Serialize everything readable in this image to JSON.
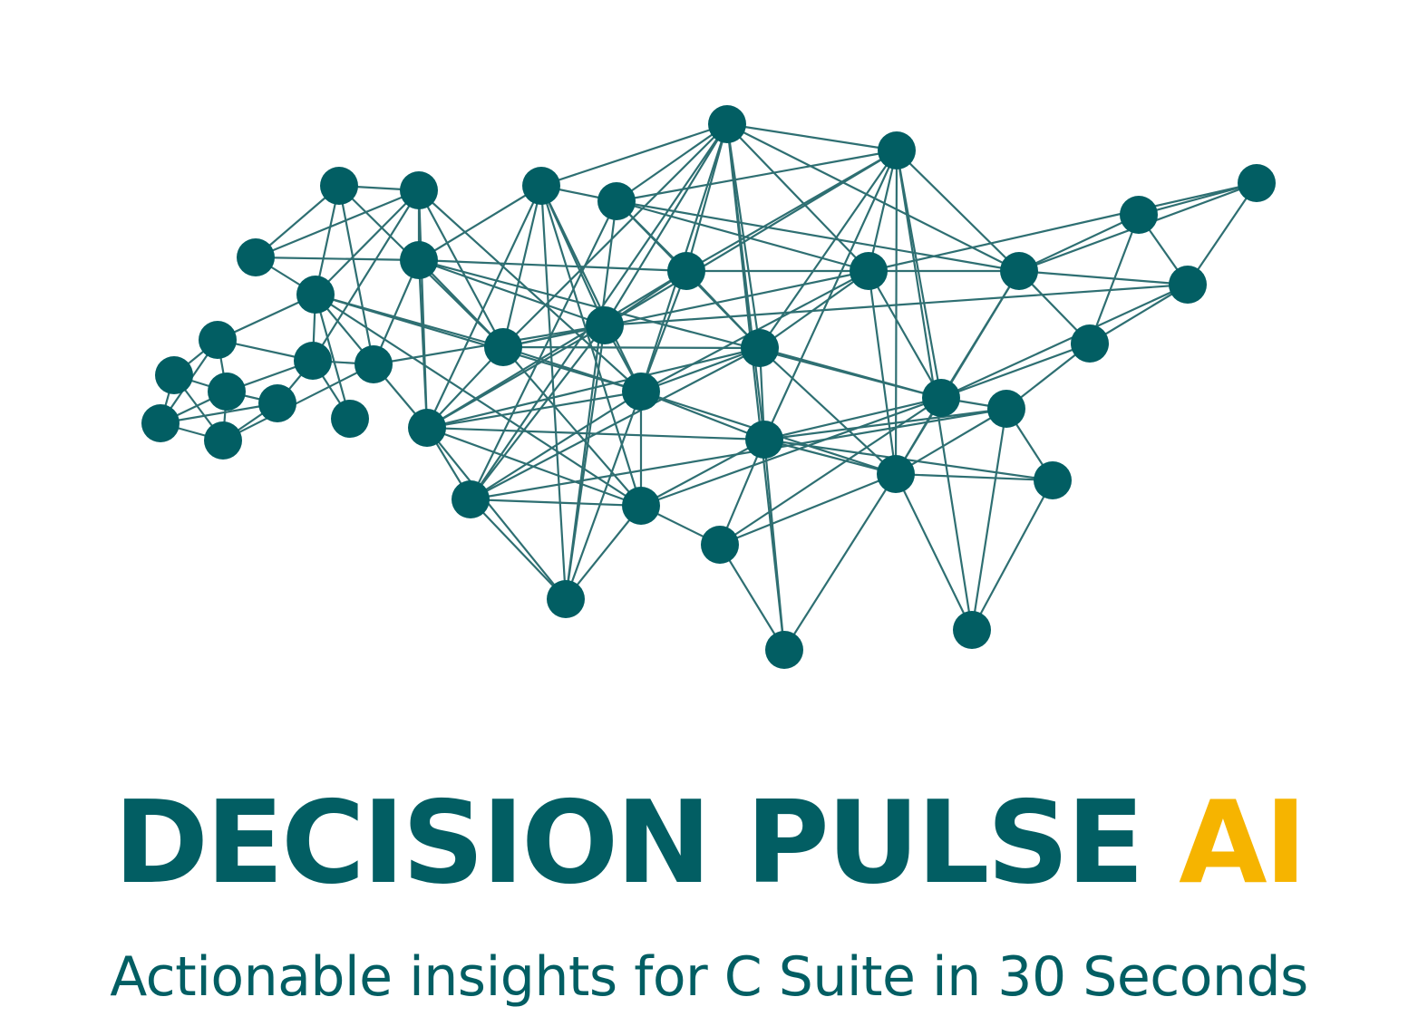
{
  "brand": {
    "title_main": "DECISION PULSE ",
    "title_accent": "AI",
    "tagline": "Actionable insights for C Suite in 30 Seconds"
  },
  "logo": {
    "icon": "network-graph-icon"
  },
  "colors": {
    "primary": "#025E63",
    "accent": "#F6B400",
    "edge": "#2E6F72",
    "background": "#FFFFFF"
  }
}
